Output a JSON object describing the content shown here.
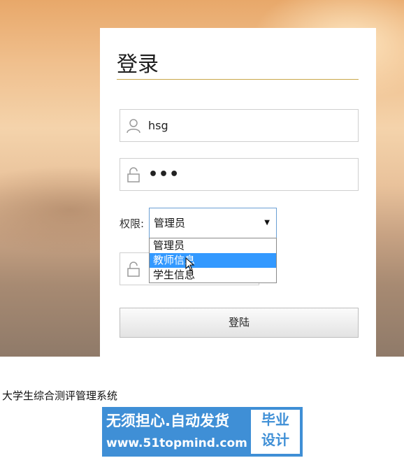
{
  "login": {
    "title": "登录",
    "username": "hsg",
    "password": "•••",
    "role_label": "权限:",
    "role_selected": "管理员",
    "role_options": [
      "管理员",
      "教师信息",
      "学生信息"
    ],
    "submit_label": "登陆"
  },
  "footer": {
    "system_name": "大学生综合测评管理系统"
  },
  "watermark": {
    "line1": "无须担心.自动发货",
    "line2": "www.51topmind.com",
    "side_top": "毕业",
    "side_bottom": "设计"
  },
  "colors": {
    "accent": "#3399ff",
    "title_underline": "#c9a74a",
    "watermark_bg": "#3f8fd6"
  },
  "icons": {
    "username": "user-icon",
    "password": "unlock-icon",
    "select_arrow": "caret-down-icon",
    "cursor": "mouse-cursor-icon"
  }
}
